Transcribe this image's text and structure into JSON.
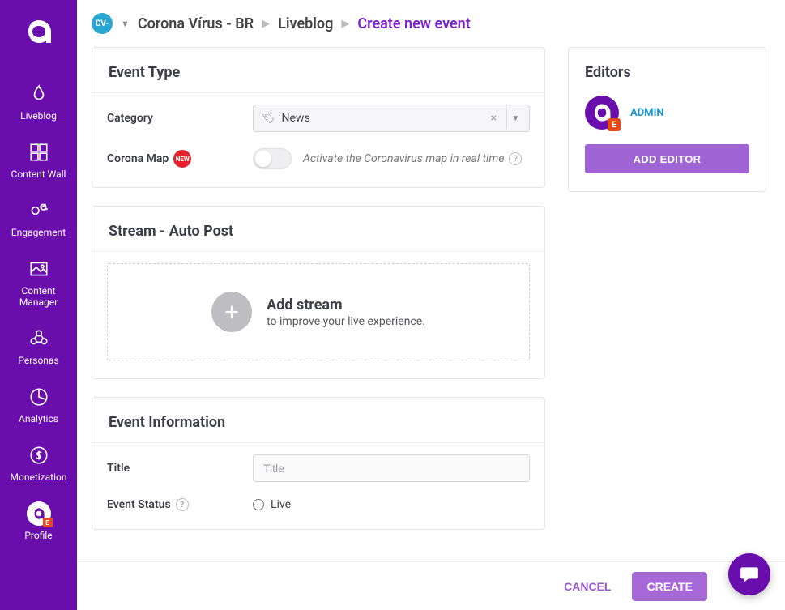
{
  "sidebar": {
    "items": [
      {
        "label": "Liveblog"
      },
      {
        "label": "Content Wall"
      },
      {
        "label": "Engagement"
      },
      {
        "label": "Content Manager"
      },
      {
        "label": "Personas"
      },
      {
        "label": "Analytics"
      },
      {
        "label": "Monetization"
      },
      {
        "label": "Profile"
      }
    ]
  },
  "breadcrumb": {
    "project_badge": "CV-",
    "items": [
      "Corona Vírus - BR",
      "Liveblog",
      "Create new event"
    ]
  },
  "event_type": {
    "title": "Event Type",
    "category_label": "Category",
    "category_value": "News",
    "corona_label": "Corona Map",
    "corona_badge": "NEW",
    "corona_toggle_hint": "Activate the Coronavirus map in real time"
  },
  "stream": {
    "title": "Stream - Auto Post",
    "add_title": "Add stream",
    "add_subtitle": "to improve your live experience."
  },
  "event_info": {
    "title": "Event Information",
    "title_label": "Title",
    "title_placeholder": "Title",
    "status_label": "Event Status",
    "status_option": "Live"
  },
  "editors": {
    "title": "Editors",
    "list": [
      {
        "name": "ADMIN"
      }
    ],
    "add_button": "ADD EDITOR"
  },
  "footer": {
    "cancel": "CANCEL",
    "create": "CREATE"
  }
}
